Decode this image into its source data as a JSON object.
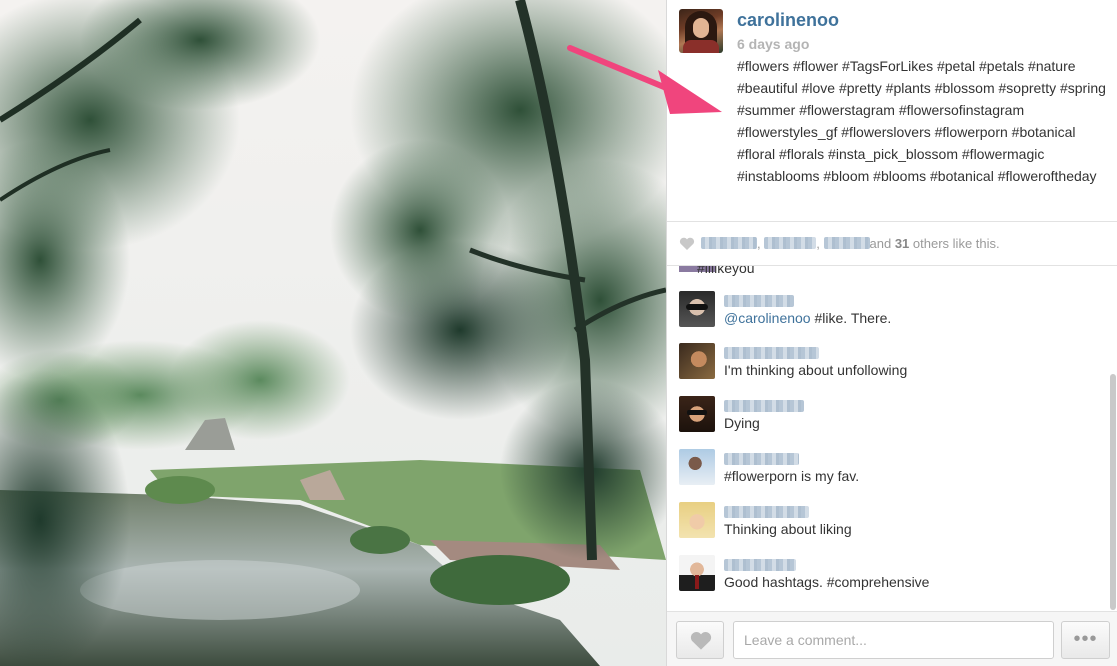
{
  "post": {
    "username": "carolinenoo",
    "age": "6 days ago",
    "caption": "#flowers #flower #TagsForLikes #petal #petals #nature #beautiful #love #pretty #plants #blossom #sopretty #spring #summer #flowerstagram #flowersofinstagram #flowerstyles_gf #flowerslovers #flowerporn #botanical #floral #florals #insta_pick_blossom #flowermagic #instablooms #bloom #blooms #botanical #floweroftheday"
  },
  "likes": {
    "and_text": "and",
    "count": "31",
    "suffix": "others like this.",
    "separator": ","
  },
  "comments": {
    "partial_text": "#ililkeyou",
    "items": [
      {
        "avatar": "woman-sunglasses",
        "text_mention": "@carolinenoo",
        "text": " #like. There."
      },
      {
        "avatar": "man-dark",
        "text_mention": "",
        "text": "I'm thinking about unfollowing"
      },
      {
        "avatar": "man-glasses",
        "text_mention": "",
        "text": "Dying"
      },
      {
        "avatar": "couple-sky",
        "text_mention": "",
        "text": "#flowerporn is my fav."
      },
      {
        "avatar": "blonde-woman",
        "text_mention": "",
        "text": "Thinking about liking"
      },
      {
        "avatar": "man-suit",
        "text_mention": "",
        "text": "Good hashtags. #comprehensive"
      }
    ]
  },
  "composer": {
    "placeholder": "Leave a comment...",
    "more_label": "•••"
  },
  "icons": {
    "like": "heart-icon",
    "more": "ellipsis-icon",
    "annotation": "pink-arrow-icon"
  },
  "colors": {
    "link": "#3f729b",
    "arrow": "#f0457d",
    "muted": "#b4b4b4"
  }
}
